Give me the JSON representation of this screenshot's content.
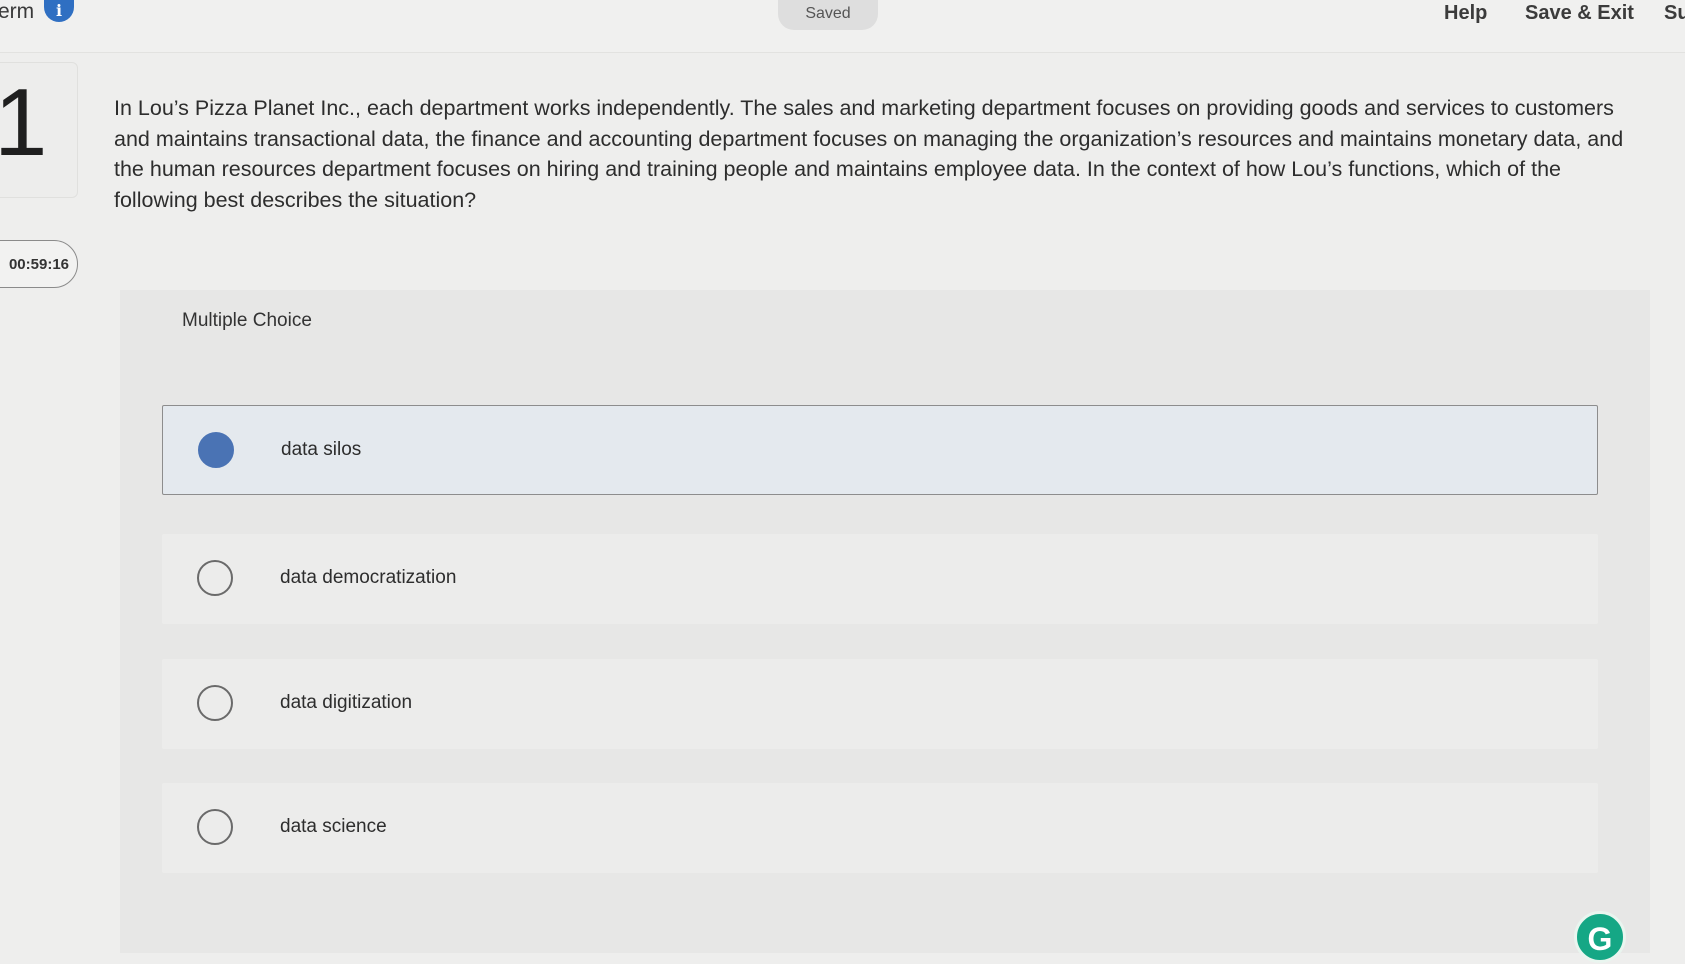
{
  "header": {
    "term_label": "erm",
    "info_icon": "info-icon",
    "status": "Saved",
    "help_label": "Help",
    "save_exit_label": "Save & Exit",
    "submit_partial": "Su"
  },
  "sidebar": {
    "question_number": "1",
    "timer": "00:59:16"
  },
  "question": {
    "text": "In Lou’s Pizza Planet Inc., each department works independently. The sales and marketing department focuses on providing goods and services to customers and maintains transactional data, the finance and accounting department focuses on managing the organization’s resources and maintains monetary data, and the human resources department focuses on hiring and training people and maintains employee data. In the context of how Lou’s functions, which of the following best describes the situation?",
    "type_label": "Multiple Choice",
    "selected_index": 0,
    "options": [
      {
        "label": "data silos"
      },
      {
        "label": "data democratization"
      },
      {
        "label": "data digitization"
      },
      {
        "label": "data science"
      }
    ]
  },
  "extension": {
    "grammarly_glyph": "G"
  },
  "colors": {
    "selected_radio": "#4a73b4",
    "selected_option_bg": "#e4e9ee",
    "info_icon": "#2f6fc2",
    "grammarly": "#15a785"
  }
}
